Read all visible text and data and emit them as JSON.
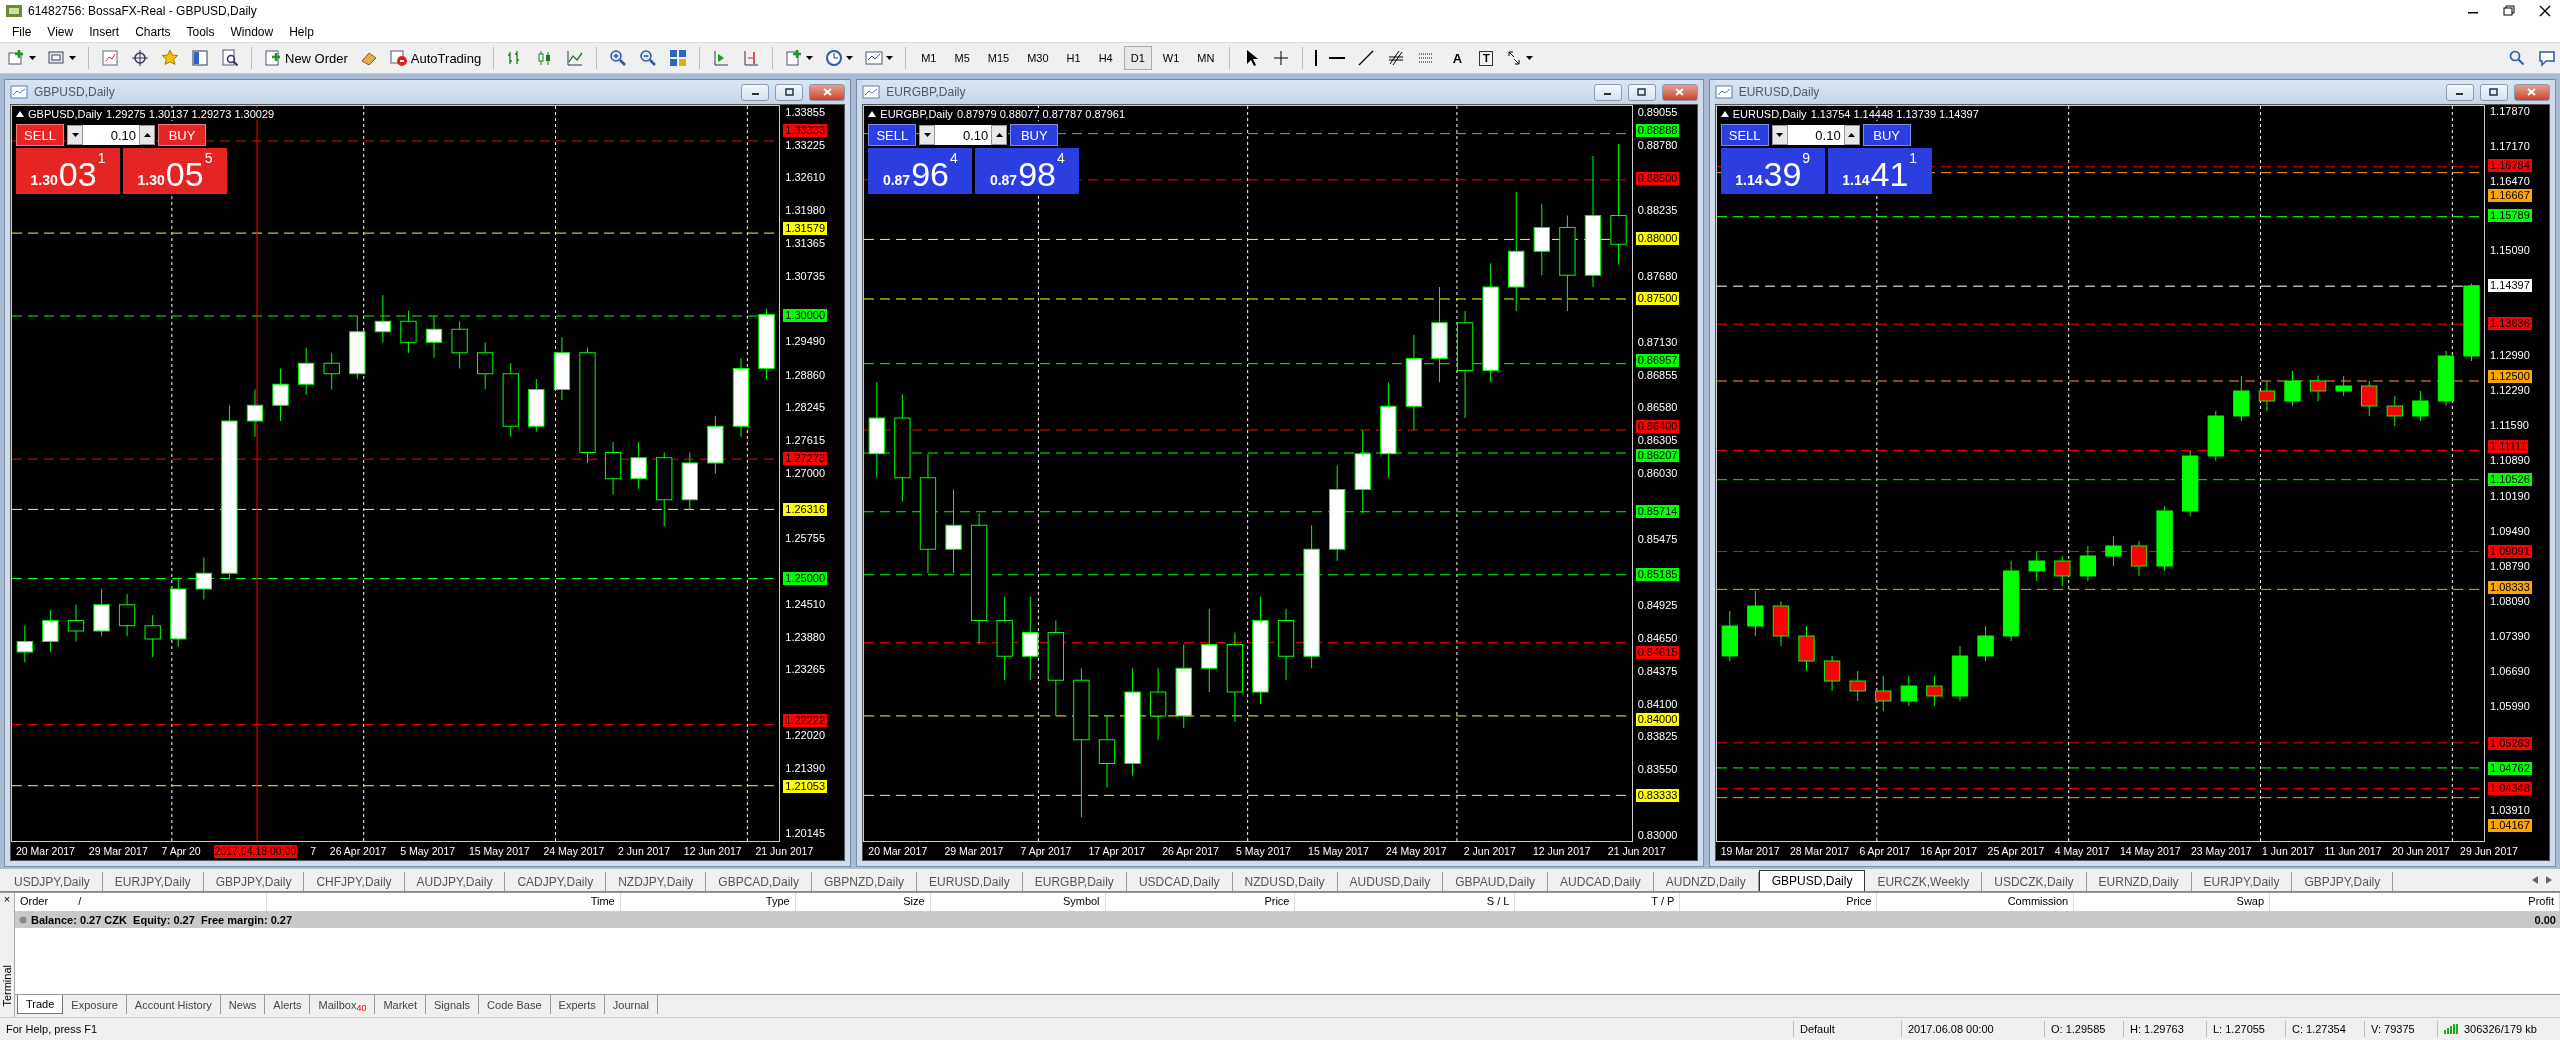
{
  "window": {
    "title": "61482756: BossaFX-Real - GBPUSD,Daily"
  },
  "menu": [
    "File",
    "View",
    "Insert",
    "Charts",
    "Tools",
    "Window",
    "Help"
  ],
  "toolbar": {
    "new_order": "New Order",
    "autotrading": "AutoTrading",
    "tool_glyphs": [
      "A",
      "T"
    ],
    "timeframes": [
      {
        "label": "M1",
        "selected": false
      },
      {
        "label": "M5",
        "selected": false
      },
      {
        "label": "M15",
        "selected": false
      },
      {
        "label": "M30",
        "selected": false
      },
      {
        "label": "H1",
        "selected": false
      },
      {
        "label": "H4",
        "selected": false
      },
      {
        "label": "D1",
        "selected": true
      },
      {
        "label": "W1",
        "selected": false
      },
      {
        "label": "MN",
        "selected": false
      }
    ]
  },
  "charts": [
    {
      "title": "GBPUSD,Daily",
      "symbol": "GBPUSD,Daily",
      "ohlc": "1.29275 1.30137 1.29273 1.30029",
      "color": "#e52424",
      "trade": {
        "sell": "SELL",
        "buy": "BUY",
        "lot": "0.10",
        "bid": {
          "prefix": "1.30",
          "pips": "03",
          "point": "1"
        },
        "ask": {
          "prefix": "1.30",
          "pips": "05",
          "point": "5"
        }
      },
      "kind": "outlined",
      "dates": [
        {
          "text": "20 Mar 2017"
        },
        {
          "text": "29 Mar 2017"
        },
        {
          "text": "7 Apr 20"
        },
        {
          "text": "2017.04.18 00:00",
          "color": "#ff0000"
        },
        {
          "text": "7"
        },
        {
          "text": "26 Apr 2017"
        },
        {
          "text": "5 May 2017"
        },
        {
          "text": "15 May 2017"
        },
        {
          "text": "24 May 2017"
        },
        {
          "text": "2 Jun 2017"
        },
        {
          "text": "12 Jun 2017"
        },
        {
          "text": "21 Jun 2017"
        }
      ],
      "chart_data": {
        "type": "candlestick",
        "ylim": [
          1.2,
          1.34
        ],
        "ref_lines": [
          {
            "axis": "y",
            "value": 1.33333,
            "label": "1.33333",
            "color": "#ff0000"
          },
          {
            "axis": "y",
            "value": 1.31579,
            "label": "1.31579",
            "color": "#ffff00"
          },
          {
            "axis": "y",
            "value": 1.3,
            "label": "1.30000",
            "color": "#00ff00"
          },
          {
            "axis": "y",
            "value": 1.27273,
            "label": "1.27273",
            "color": "#ff0000"
          },
          {
            "axis": "y",
            "value": 1.26316,
            "label": "1.26316",
            "color": "#ffff00"
          },
          {
            "axis": "y",
            "value": 1.25,
            "label": "1.25000",
            "color": "#00ff00"
          },
          {
            "axis": "y",
            "value": 1.22222,
            "label": "1.22222",
            "color": "#ff0000"
          },
          {
            "axis": "y",
            "value": 1.21053,
            "label": "1.21053",
            "color": "#ffff00"
          }
        ],
        "yticks": [
          {
            "value": 1.33855,
            "label": "1.33855"
          },
          {
            "value": 1.33225,
            "label": "1.33225"
          },
          {
            "value": 1.3261,
            "label": "1.32610"
          },
          {
            "value": 1.3198,
            "label": "1.31980"
          },
          {
            "value": 1.31365,
            "label": "1.31365"
          },
          {
            "value": 1.30735,
            "label": "1.30735"
          },
          {
            "value": 1.2949,
            "label": "1.29490"
          },
          {
            "value": 1.2886,
            "label": "1.28860"
          },
          {
            "value": 1.28245,
            "label": "1.28245"
          },
          {
            "value": 1.27615,
            "label": "1.27615"
          },
          {
            "value": 1.27,
            "label": "1.27000"
          },
          {
            "value": 1.25755,
            "label": "1.25755"
          },
          {
            "value": 1.2451,
            "label": "1.24510"
          },
          {
            "value": 1.2388,
            "label": "1.23880"
          },
          {
            "value": 1.23265,
            "label": "1.23265"
          },
          {
            "value": 1.2202,
            "label": "1.22020"
          },
          {
            "value": 1.2139,
            "label": "1.21390"
          },
          {
            "value": 1.20145,
            "label": "1.20145"
          }
        ],
        "categories": [
          null,
          null,
          null,
          null,
          null,
          null,
          null,
          null,
          null,
          null,
          null,
          null,
          null,
          null,
          null,
          null,
          null,
          null,
          null,
          null,
          null,
          null,
          null,
          null,
          null,
          null,
          null,
          null,
          null,
          null
        ],
        "ohlc": [
          [
            1.236,
            1.241,
            1.234,
            1.238
          ],
          [
            1.238,
            1.244,
            1.236,
            1.242
          ],
          [
            1.242,
            1.245,
            1.238,
            1.24
          ],
          [
            1.24,
            1.248,
            1.239,
            1.245
          ],
          [
            1.245,
            1.247,
            1.239,
            1.241
          ],
          [
            1.241,
            1.243,
            1.235,
            1.2385
          ],
          [
            1.2385,
            1.25,
            1.237,
            1.248
          ],
          [
            1.248,
            1.254,
            1.246,
            1.251
          ],
          [
            1.251,
            1.283,
            1.25,
            1.28
          ],
          [
            1.28,
            1.286,
            1.277,
            1.283
          ],
          [
            1.283,
            1.29,
            1.28,
            1.287
          ],
          [
            1.287,
            1.294,
            1.285,
            1.291
          ],
          [
            1.291,
            1.293,
            1.286,
            1.289
          ],
          [
            1.289,
            1.3,
            1.288,
            1.297
          ],
          [
            1.297,
            1.304,
            1.295,
            1.299
          ],
          [
            1.299,
            1.301,
            1.293,
            1.295
          ],
          [
            1.295,
            1.3,
            1.292,
            1.2975
          ],
          [
            1.2975,
            1.299,
            1.29,
            1.293
          ],
          [
            1.293,
            1.295,
            1.286,
            1.289
          ],
          [
            1.289,
            1.291,
            1.277,
            1.279
          ],
          [
            1.279,
            1.288,
            1.278,
            1.286
          ],
          [
            1.286,
            1.296,
            1.284,
            1.293
          ],
          [
            1.293,
            1.294,
            1.272,
            1.274
          ],
          [
            1.274,
            1.276,
            1.266,
            1.269
          ],
          [
            1.269,
            1.276,
            1.267,
            1.273
          ],
          [
            1.273,
            1.274,
            1.26,
            1.265
          ],
          [
            1.265,
            1.274,
            1.263,
            1.272
          ],
          [
            1.272,
            1.281,
            1.27,
            1.279
          ],
          [
            1.279,
            1.292,
            1.277,
            1.29
          ],
          [
            1.29,
            1.3014,
            1.288,
            1.3003
          ]
        ]
      }
    },
    {
      "title": "EURGBP,Daily",
      "symbol": "EURGBP,Daily",
      "ohlc": "0.87979 0.88077 0.87787 0.87961",
      "color": "#2b3fe0",
      "trade": {
        "sell": "SELL",
        "buy": "BUY",
        "lot": "0.10",
        "bid": {
          "prefix": "0.87",
          "pips": "96",
          "point": "4"
        },
        "ask": {
          "prefix": "0.87",
          "pips": "98",
          "point": "4"
        }
      },
      "kind": "outlined",
      "dates": [
        {
          "text": "20 Mar 2017"
        },
        {
          "text": "29 Mar 2017"
        },
        {
          "text": "7 Apr 2017"
        },
        {
          "text": "17 Apr 2017"
        },
        {
          "text": "26 Apr 2017"
        },
        {
          "text": "5 May 2017"
        },
        {
          "text": "15 May 2017"
        },
        {
          "text": "24 May 2017"
        },
        {
          "text": "2 Jun 2017"
        },
        {
          "text": "12 Jun 2017"
        },
        {
          "text": "21 Jun 2017"
        }
      ],
      "chart_data": {
        "type": "candlestick",
        "ylim": [
          0.8295,
          0.8912
        ],
        "ref_lines": [
          {
            "axis": "y",
            "value": 0.88888,
            "label": "0.88888",
            "color": "#00ff00"
          },
          {
            "axis": "y",
            "value": 0.885,
            "label": "0.88500",
            "color": "#ff0000"
          },
          {
            "axis": "y",
            "value": 0.88,
            "label": "0.88000",
            "color": "#ffff00"
          },
          {
            "axis": "y",
            "value": 0.875,
            "label": "0.87500",
            "color": "#ffff00"
          },
          {
            "axis": "y",
            "value": 0.86957,
            "label": "0.86957",
            "color": "#00ff00"
          },
          {
            "axis": "y",
            "value": 0.864,
            "label": "0.86400",
            "color": "#ff0000"
          },
          {
            "axis": "y",
            "value": 0.86207,
            "label": "0.86207",
            "color": "#00ff00"
          },
          {
            "axis": "y",
            "value": 0.85714,
            "label": "0.85714",
            "color": "#00ff00"
          },
          {
            "axis": "y",
            "value": 0.85185,
            "label": "0.85185",
            "color": "#00ff00"
          },
          {
            "axis": "y",
            "value": 0.84615,
            "label": "0.84615",
            "color": "#ff0000"
          },
          {
            "axis": "y",
            "value": 0.84,
            "label": "0.84000",
            "color": "#ffff00"
          },
          {
            "axis": "y",
            "value": 0.83333,
            "label": "0.83333",
            "color": "#ffff00"
          }
        ],
        "yticks": [
          {
            "value": 0.89055,
            "label": "0.89055"
          },
          {
            "value": 0.8878,
            "label": "0.88780"
          },
          {
            "value": 0.88235,
            "label": "0.88235"
          },
          {
            "value": 0.8768,
            "label": "0.87680"
          },
          {
            "value": 0.8713,
            "label": "0.87130"
          },
          {
            "value": 0.86855,
            "label": "0.86855"
          },
          {
            "value": 0.8658,
            "label": "0.86580"
          },
          {
            "value": 0.86305,
            "label": "0.86305"
          },
          {
            "value": 0.8603,
            "label": "0.86030"
          },
          {
            "value": 0.85475,
            "label": "0.85475"
          },
          {
            "value": 0.84925,
            "label": "0.84925"
          },
          {
            "value": 0.8465,
            "label": "0.84650"
          },
          {
            "value": 0.84375,
            "label": "0.84375"
          },
          {
            "value": 0.841,
            "label": "0.84100"
          },
          {
            "value": 0.83825,
            "label": "0.83825"
          },
          {
            "value": 0.8355,
            "label": "0.83550"
          },
          {
            "value": 0.83,
            "label": "0.83000"
          }
        ],
        "categories": [
          null,
          null,
          null,
          null,
          null,
          null,
          null,
          null,
          null,
          null,
          null,
          null,
          null,
          null,
          null,
          null,
          null,
          null,
          null,
          null,
          null,
          null,
          null,
          null,
          null,
          null,
          null,
          null,
          null,
          null
        ],
        "ohlc": [
          [
            0.862,
            0.868,
            0.86,
            0.865
          ],
          [
            0.865,
            0.867,
            0.858,
            0.86
          ],
          [
            0.86,
            0.862,
            0.852,
            0.854
          ],
          [
            0.854,
            0.859,
            0.852,
            0.856
          ],
          [
            0.856,
            0.857,
            0.846,
            0.848
          ],
          [
            0.848,
            0.85,
            0.843,
            0.845
          ],
          [
            0.845,
            0.85,
            0.843,
            0.847
          ],
          [
            0.847,
            0.848,
            0.84,
            0.843
          ],
          [
            0.843,
            0.844,
            0.8315,
            0.838
          ],
          [
            0.838,
            0.84,
            0.834,
            0.836
          ],
          [
            0.836,
            0.844,
            0.835,
            0.842
          ],
          [
            0.842,
            0.844,
            0.838,
            0.84
          ],
          [
            0.84,
            0.846,
            0.839,
            0.844
          ],
          [
            0.844,
            0.849,
            0.842,
            0.846
          ],
          [
            0.846,
            0.847,
            0.8395,
            0.842
          ],
          [
            0.842,
            0.85,
            0.841,
            0.848
          ],
          [
            0.848,
            0.849,
            0.843,
            0.845
          ],
          [
            0.845,
            0.856,
            0.844,
            0.854
          ],
          [
            0.854,
            0.861,
            0.853,
            0.859
          ],
          [
            0.859,
            0.864,
            0.857,
            0.862
          ],
          [
            0.862,
            0.868,
            0.86,
            0.866
          ],
          [
            0.866,
            0.872,
            0.864,
            0.87
          ],
          [
            0.87,
            0.876,
            0.868,
            0.873
          ],
          [
            0.873,
            0.874,
            0.865,
            0.869
          ],
          [
            0.869,
            0.878,
            0.868,
            0.876
          ],
          [
            0.876,
            0.884,
            0.874,
            0.879
          ],
          [
            0.879,
            0.883,
            0.877,
            0.881
          ],
          [
            0.881,
            0.882,
            0.874,
            0.877
          ],
          [
            0.877,
            0.887,
            0.876,
            0.882
          ],
          [
            0.882,
            0.888,
            0.8779,
            0.8796
          ]
        ]
      }
    },
    {
      "title": "EURUSD,Daily",
      "symbol": "EURUSD,Daily",
      "ohlc": "1.13754 1.14448 1.13739 1.14397",
      "color": "#2b3fe0",
      "trade": {
        "sell": "SELL",
        "buy": "BUY",
        "lot": "0.10",
        "bid": {
          "prefix": "1.14",
          "pips": "39",
          "point": "9"
        },
        "ask": {
          "prefix": "1.14",
          "pips": "41",
          "point": "1"
        }
      },
      "kind": "colored",
      "dates": [
        {
          "text": "19 Mar 2017"
        },
        {
          "text": "28 Mar 2017"
        },
        {
          "text": "6 Apr 2017"
        },
        {
          "text": "16 Apr 2017"
        },
        {
          "text": "25 Apr 2017"
        },
        {
          "text": "4 May 2017"
        },
        {
          "text": "14 May 2017"
        },
        {
          "text": "23 May 2017"
        },
        {
          "text": "1 Jun 2017"
        },
        {
          "text": "11 Jun 2017"
        },
        {
          "text": "20 Jun 2017"
        },
        {
          "text": "29 Jun 2017"
        }
      ],
      "chart_data": {
        "type": "candlestick",
        "ylim": [
          1.033,
          1.18
        ],
        "ref_lines": [
          {
            "axis": "y",
            "value": 1.16784,
            "label": "1.16784",
            "color": "#ff0000"
          },
          {
            "axis": "y",
            "value": 1.16667,
            "label": "1.16667",
            "color": "#ffa500"
          },
          {
            "axis": "y",
            "value": 1.15789,
            "label": "1.15789",
            "color": "#00ff00"
          },
          {
            "axis": "y",
            "value": 1.14397,
            "label": "1.14397",
            "color": "#ffffff"
          },
          {
            "axis": "y",
            "value": 1.13636,
            "label": "1.13636",
            "color": "#ff0000"
          },
          {
            "axis": "y",
            "value": 1.125,
            "label": "1.12500",
            "color": "#ffa500"
          },
          {
            "axis": "y",
            "value": 1.11111,
            "label": "1.11111",
            "color": "#ff0000"
          },
          {
            "axis": "y",
            "value": 1.10526,
            "label": "1.10526",
            "color": "#00ff00"
          },
          {
            "axis": "y",
            "value": 1.09091,
            "label": "1.09091",
            "color": "#ff0000"
          },
          {
            "axis": "y",
            "value": 1.08333,
            "label": "1.08333",
            "color": "#ffa500"
          },
          {
            "axis": "y",
            "value": 1.05263,
            "label": "1.05263",
            "color": "#ff0000"
          },
          {
            "axis": "y",
            "value": 1.04762,
            "label": "1.04762",
            "color": "#00ff00"
          },
          {
            "axis": "y",
            "value": 1.04348,
            "label": "1.04348",
            "color": "#ff0000"
          },
          {
            "axis": "y",
            "value": 1.04167,
            "label": "1.04167",
            "color": "#ffa500"
          }
        ],
        "yticks": [
          {
            "value": 1.1787,
            "label": "1.17870"
          },
          {
            "value": 1.1717,
            "label": "1.17170"
          },
          {
            "value": 1.1647,
            "label": "1.16470"
          },
          {
            "value": 1.1509,
            "label": "1.15090"
          },
          {
            "value": 1.1299,
            "label": "1.12990"
          },
          {
            "value": 1.1229,
            "label": "1.12290"
          },
          {
            "value": 1.1159,
            "label": "1.11590"
          },
          {
            "value": 1.1089,
            "label": "1.10890"
          },
          {
            "value": 1.1019,
            "label": "1.10190"
          },
          {
            "value": 1.0949,
            "label": "1.09490"
          },
          {
            "value": 1.0879,
            "label": "1.08790"
          },
          {
            "value": 1.0809,
            "label": "1.08090"
          },
          {
            "value": 1.0739,
            "label": "1.07390"
          },
          {
            "value": 1.0669,
            "label": "1.06690"
          },
          {
            "value": 1.0599,
            "label": "1.05990"
          },
          {
            "value": 1.0391,
            "label": "1.03910"
          }
        ],
        "categories": [
          null,
          null,
          null,
          null,
          null,
          null,
          null,
          null,
          null,
          null,
          null,
          null,
          null,
          null,
          null,
          null,
          null,
          null,
          null,
          null,
          null,
          null,
          null,
          null,
          null,
          null,
          null,
          null,
          null,
          null
        ],
        "ohlc": [
          [
            1.07,
            1.079,
            1.069,
            1.076
          ],
          [
            1.076,
            1.083,
            1.074,
            1.08
          ],
          [
            1.08,
            1.081,
            1.072,
            1.074
          ],
          [
            1.074,
            1.076,
            1.067,
            1.069
          ],
          [
            1.069,
            1.07,
            1.063,
            1.065
          ],
          [
            1.065,
            1.067,
            1.061,
            1.063
          ],
          [
            1.063,
            1.066,
            1.059,
            1.061
          ],
          [
            1.061,
            1.066,
            1.06,
            1.064
          ],
          [
            1.064,
            1.066,
            1.06,
            1.062
          ],
          [
            1.062,
            1.072,
            1.061,
            1.07
          ],
          [
            1.07,
            1.076,
            1.069,
            1.074
          ],
          [
            1.074,
            1.089,
            1.073,
            1.087
          ],
          [
            1.087,
            1.091,
            1.085,
            1.089
          ],
          [
            1.089,
            1.09,
            1.084,
            1.086
          ],
          [
            1.086,
            1.092,
            1.085,
            1.09
          ],
          [
            1.09,
            1.094,
            1.088,
            1.092
          ],
          [
            1.092,
            1.093,
            1.086,
            1.088
          ],
          [
            1.088,
            1.1,
            1.087,
            1.099
          ],
          [
            1.099,
            1.111,
            1.098,
            1.11
          ],
          [
            1.11,
            1.119,
            1.109,
            1.118
          ],
          [
            1.118,
            1.126,
            1.117,
            1.123
          ],
          [
            1.123,
            1.125,
            1.119,
            1.121
          ],
          [
            1.121,
            1.127,
            1.12,
            1.125
          ],
          [
            1.125,
            1.126,
            1.121,
            1.123
          ],
          [
            1.123,
            1.126,
            1.122,
            1.124
          ],
          [
            1.124,
            1.125,
            1.118,
            1.12
          ],
          [
            1.12,
            1.122,
            1.116,
            1.118
          ],
          [
            1.118,
            1.123,
            1.117,
            1.121
          ],
          [
            1.121,
            1.131,
            1.12,
            1.13
          ],
          [
            1.13,
            1.1445,
            1.129,
            1.144
          ]
        ]
      }
    }
  ],
  "symbol_tabs": [
    {
      "label": "USDJPY,Daily",
      "selected": false
    },
    {
      "label": "EURJPY,Daily",
      "selected": false
    },
    {
      "label": "GBPJPY,Daily",
      "selected": false
    },
    {
      "label": "CHFJPY,Daily",
      "selected": false
    },
    {
      "label": "AUDJPY,Daily",
      "selected": false
    },
    {
      "label": "CADJPY,Daily",
      "selected": false
    },
    {
      "label": "NZDJPY,Daily",
      "selected": false
    },
    {
      "label": "GBPCAD,Daily",
      "selected": false
    },
    {
      "label": "GBPNZD,Daily",
      "selected": false
    },
    {
      "label": "EURUSD,Daily",
      "selected": false
    },
    {
      "label": "EURGBP,Daily",
      "selected": false
    },
    {
      "label": "USDCAD,Daily",
      "selected": false
    },
    {
      "label": "NZDUSD,Daily",
      "selected": false
    },
    {
      "label": "AUDUSD,Daily",
      "selected": false
    },
    {
      "label": "GBPAUD,Daily",
      "selected": false
    },
    {
      "label": "AUDCAD,Daily",
      "selected": false
    },
    {
      "label": "AUDNZD,Daily",
      "selected": false
    },
    {
      "label": "GBPUSD,Daily",
      "selected": true
    },
    {
      "label": "EURCZK,Weekly",
      "selected": false
    },
    {
      "label": "USDCZK,Daily",
      "selected": false
    },
    {
      "label": "EURNZD,Daily",
      "selected": false
    },
    {
      "label": "EURJPY,Daily",
      "selected": false
    },
    {
      "label": "GBPJPY,Daily",
      "selected": false
    }
  ],
  "terminal": {
    "side_label": "Terminal",
    "close": "×",
    "sort_mark": "/",
    "columns": [
      "Order",
      "Time",
      "Type",
      "Size",
      "Symbol",
      "Price",
      "S / L",
      "T / P",
      "Price",
      "Commission",
      "Swap",
      "Profit"
    ],
    "balance": "Balance: 0.27 CZK  Equity: 0.27  Free margin: 0.27",
    "profit": "0.00",
    "tabs": [
      {
        "label": "Trade",
        "selected": true
      },
      {
        "label": "Exposure",
        "selected": false
      },
      {
        "label": "Account History",
        "selected": false
      },
      {
        "label": "News",
        "selected": false
      },
      {
        "label": "Alerts",
        "selected": false
      },
      {
        "label": "Mailbox",
        "badge": "40",
        "selected": false
      },
      {
        "label": "Market",
        "selected": false
      },
      {
        "label": "Signals",
        "selected": false
      },
      {
        "label": "Code Base",
        "selected": false
      },
      {
        "label": "Experts",
        "selected": false
      },
      {
        "label": "Journal",
        "selected": false
      }
    ]
  },
  "status_bar": {
    "help": "For Help, press F1",
    "profile": "Default",
    "time": "2017.06.08 00:00",
    "open": "O: 1.29585",
    "high": "H: 1.29763",
    "low": "L: 1.27055",
    "close": "C: 1.27354",
    "volume": "V: 79375",
    "traffic": "306326/179 kb"
  }
}
